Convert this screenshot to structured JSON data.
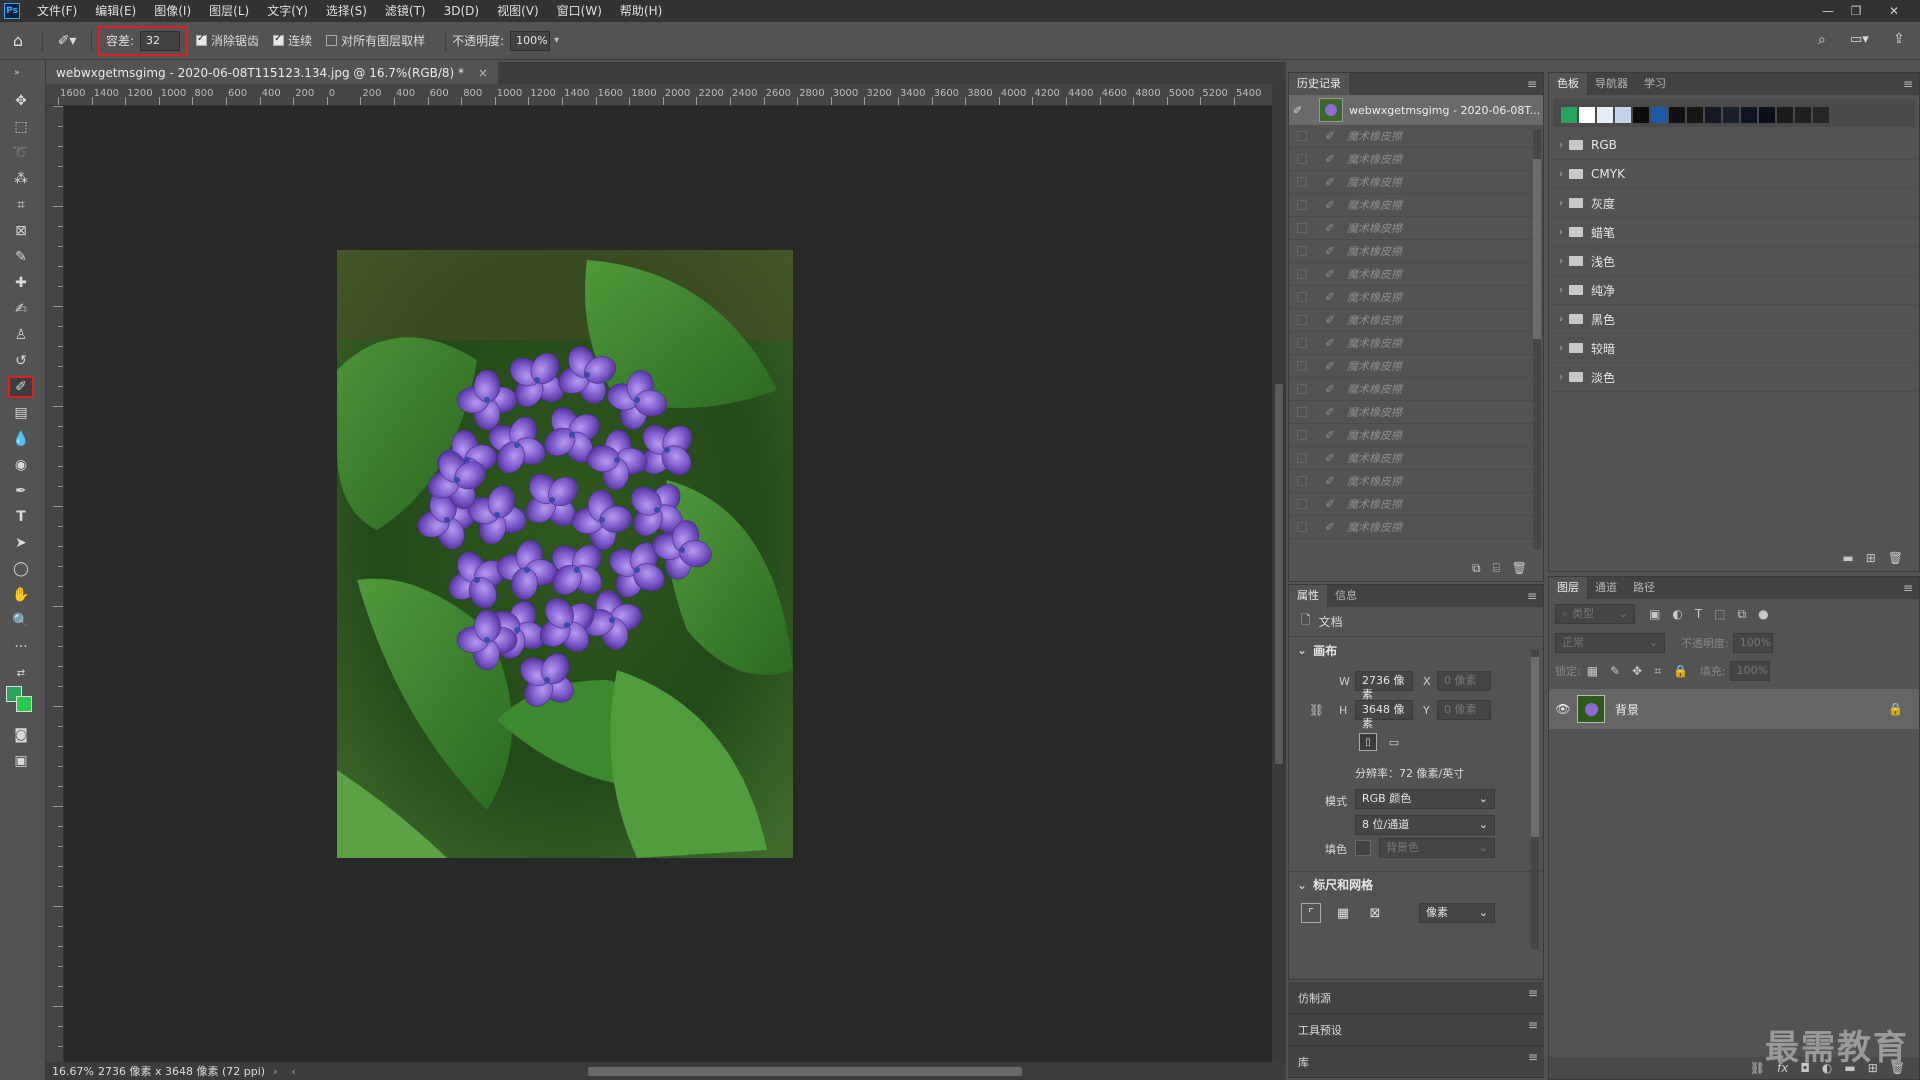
{
  "menubar": {
    "logo": "Ps",
    "items": [
      "文件(F)",
      "编辑(E)",
      "图像(I)",
      "图层(L)",
      "文字(Y)",
      "选择(S)",
      "滤镜(T)",
      "3D(D)",
      "视图(V)",
      "窗口(W)",
      "帮助(H)"
    ]
  },
  "options": {
    "tolerance_label": "容差:",
    "tolerance_value": "32",
    "antialias_label": "消除锯齿",
    "contiguous_label": "连续",
    "sample_all_label": "对所有图层取样",
    "opacity_label": "不透明度:",
    "opacity_value": "100%"
  },
  "document": {
    "tab_title": "webwxgetmsgimg - 2020-06-08T115123.134.jpg @ 16.7%(RGB/8) *",
    "zoom": "16.67%",
    "status": "2736 像素 x 3648 像素 (72 ppi)"
  },
  "ruler": {
    "h_labels": [
      "1600",
      "1400",
      "1200",
      "1000",
      "800",
      "600",
      "400",
      "200",
      "0",
      "200",
      "400",
      "600",
      "800",
      "1000",
      "1200",
      "1400",
      "1600",
      "1800",
      "2000",
      "2200",
      "2400",
      "2600",
      "2800",
      "3000",
      "3200",
      "3400",
      "3600",
      "3800",
      "4000",
      "4200",
      "4400",
      "4600",
      "4800",
      "5000",
      "5200",
      "5400"
    ]
  },
  "history": {
    "tab": "历史记录",
    "snapshot": "webwxgetmsgimg - 2020-06-08T...",
    "step_label": "魔术橡皮擦",
    "steps": 18
  },
  "swatches_panel": {
    "tabs": [
      "色板",
      "导航器",
      "学习"
    ],
    "colors": [
      "#27a35c",
      "#ffffff",
      "#e6eef8",
      "#c5d2ee",
      "#0d0d0d",
      "#1c5aa8",
      "#111111",
      "#161616",
      "#151a22",
      "#1a2029",
      "#0f1521",
      "#0b0f17",
      "#1b1b1b",
      "#202020",
      "#262626"
    ],
    "folders": [
      "RGB",
      "CMYK",
      "灰度",
      "蜡笔",
      "浅色",
      "纯净",
      "黑色",
      "较暗",
      "淡色"
    ]
  },
  "properties": {
    "tabs": [
      "属性",
      "信息"
    ],
    "doc_label": "文档",
    "canvas_label": "画布",
    "w_label": "W",
    "w_value": "2736 像素",
    "h_label": "H",
    "h_value": "3648 像素",
    "x_label": "X",
    "x_value": "0 像素",
    "y_label": "Y",
    "y_value": "0 像素",
    "resolution": "分辨率：72 像素/英寸",
    "mode_label": "模式",
    "mode_value": "RGB 颜色",
    "depth_value": "8 位/通道",
    "fill_label": "填色",
    "fill_value": "背景色",
    "rulers_label": "标尺和网格",
    "unit_value": "像素"
  },
  "collapsed_panels": [
    "仿制源",
    "工具预设",
    "库"
  ],
  "layers": {
    "tabs": [
      "图层",
      "通道",
      "路径"
    ],
    "filter_placeholder": "类型",
    "blend": "正常",
    "opacity_label": "不透明度:",
    "opacity_value": "100%",
    "lock_label": "锁定:",
    "fill_label": "填充:",
    "fill_value": "100%",
    "layer_name": "背景"
  },
  "watermark": "最需教育"
}
